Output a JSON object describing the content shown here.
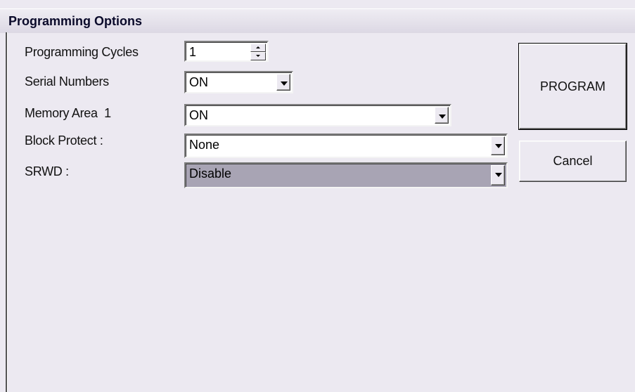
{
  "window": {
    "title": "Programming Options"
  },
  "form": {
    "programming_cycles": {
      "label": "Programming Cycles",
      "value": "1"
    },
    "serial_numbers": {
      "label": "Serial Numbers",
      "value": "ON"
    },
    "memory_area": {
      "label": "Memory Area  1",
      "value": "ON"
    },
    "block_protect": {
      "label": "Block Protect :",
      "value": "None"
    },
    "srwd": {
      "label": "SRWD :",
      "value": "Disable"
    }
  },
  "buttons": {
    "program": "PROGRAM",
    "cancel": "Cancel"
  },
  "icons": {
    "spin_up": "spin-up-icon",
    "spin_down": "spin-down-icon",
    "dropdown": "chevron-down-icon"
  },
  "colors": {
    "window_bg": "#ece9f1",
    "selected_field_bg": "#a8a4b4"
  }
}
